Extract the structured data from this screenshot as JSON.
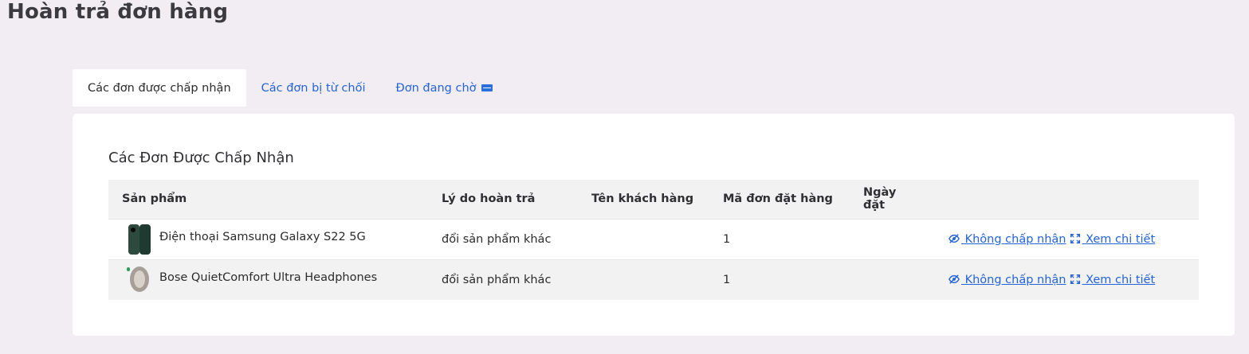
{
  "page": {
    "title": "Hoàn trả đơn hàng"
  },
  "tabs": [
    {
      "label": "Các đơn được chấp nhận",
      "active": true
    },
    {
      "label": "Các đơn bị từ chối",
      "active": false
    },
    {
      "label": "Đơn đang chờ",
      "active": false,
      "badge_icon": "new-badge-icon"
    }
  ],
  "card": {
    "title": "Các Đơn Được Chấp Nhận"
  },
  "table": {
    "headers": [
      "Sản phẩm",
      "Lý do hoàn trả",
      "Tên khách hàng",
      "Mã đơn đặt hàng",
      "Ngày đặt",
      ""
    ],
    "rows": [
      {
        "product": "Điện thoại Samsung Galaxy S22 5G",
        "reason": "đổi sản phẩm khác",
        "customer": "",
        "order_id": "1",
        "date": "",
        "reject_label": " Không chấp nhận",
        "detail_label": " Xem chi tiết"
      },
      {
        "product": "Bose QuietComfort Ultra Headphones",
        "reason": "đổi sản phẩm khác",
        "customer": "",
        "order_id": "1",
        "date": "",
        "reject_label": " Không chấp nhận",
        "detail_label": " Xem chi tiết"
      }
    ]
  },
  "colors": {
    "link": "#2563d9",
    "background": "#f1edf3",
    "header_bg": "#f2f2f2"
  }
}
